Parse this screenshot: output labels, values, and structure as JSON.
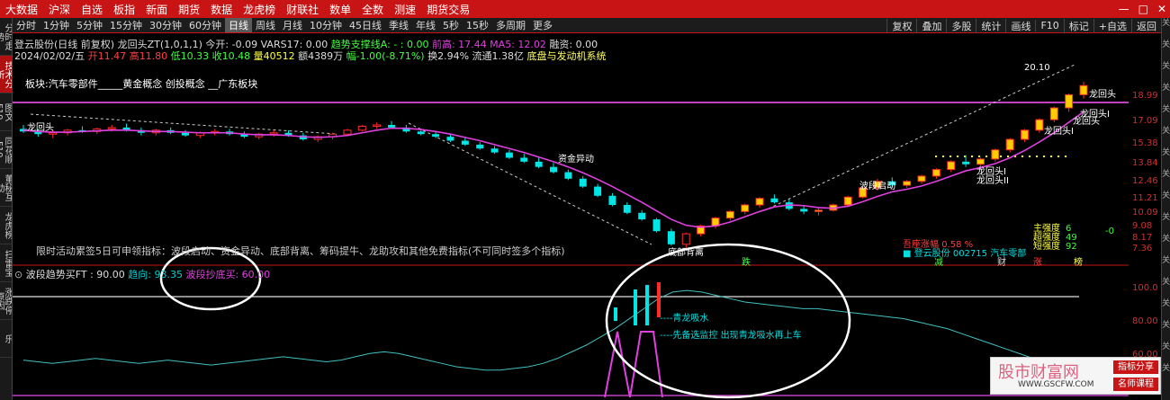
{
  "menu": [
    "大数据",
    "沪深",
    "自选",
    "板指",
    "新面",
    "期货",
    "数据",
    "龙虎榜",
    "财联社",
    "数单",
    "全数",
    "测速",
    "期货交易"
  ],
  "window_controls": [
    "—",
    "□",
    "✕"
  ],
  "left_rail": [
    "分时走势",
    "技术分析",
    "图文F10",
    "同花顺F10",
    "董秘互动",
    "龙虎榜",
    "扫雷宝",
    "涨跌停原因",
    "乐"
  ],
  "right_rail": [
    "关",
    "关",
    "关",
    "关",
    "关",
    "关",
    "关",
    "关",
    "关",
    "关",
    "关",
    "关",
    "关",
    "关",
    "关",
    "关",
    "关"
  ],
  "periods": [
    "分时",
    "1分钟",
    "5分钟",
    "15分钟",
    "30分钟",
    "60分钟",
    "日线",
    "周线",
    "月线",
    "10分钟",
    "45日线",
    "季线",
    "年线",
    "5秒",
    "15秒",
    "多周期",
    "更多"
  ],
  "period_selected": "日线",
  "toolbar_right": [
    "复权",
    "叠加",
    "多股",
    "统计",
    "画线",
    "F10",
    "标记",
    "+自选",
    "返回"
  ],
  "info_line1": {
    "name": "登云股份(日线 前复权)",
    "ind": "龙回头ZT(1,0,1,1)",
    "open": "今开: -0.09",
    "vars": "VARS17: 0.00",
    "support": "趋势支撑线A: - : 0.00",
    "high": "前高: 17.44",
    "ma5": "MA5: 12.02",
    "rz": "融资: 0.00"
  },
  "info_line2": {
    "date": "2024/02/02/五",
    "o": "开11.47",
    "h": "高11.80",
    "l": "低10.33",
    "c": "收10.48",
    "v": "量40512",
    "amt": "额4389万",
    "chg": "幅-1.00(-8.71%)",
    "turn": "换2.94%",
    "flow": "流通1.38亿",
    "concept": "底盘与发动机系统"
  },
  "plate": "板块:汽车零部件_____黄金概念 创投概念 __广东板块",
  "promo": "限时活动累签5日可申领指标：波段启动、资金异动、底部背离、筹码提牛、龙助攻和其他免费指标(不可同时签多个指标)",
  "indicator": {
    "title": "波段趋势买FT : 90.00",
    "trend": "趋向: 93.35",
    "buy": "波段抄底买: 60.00"
  },
  "y_main": [
    "18.99",
    "17.09",
    "15.38",
    "13.84",
    "12.46",
    "11.21",
    "10.09",
    "9.08",
    "8.17",
    "7.36"
  ],
  "y_sub": [
    "100.0",
    "80.00",
    "60.00"
  ],
  "annotations": {
    "peak": "20.10",
    "long1": "龙回头",
    "long2": "龙回头I",
    "long3": "龙回头",
    "long4": "龙回头I",
    "long5": "龙回头II",
    "long_left": "龙回头",
    "fund": "资金异动",
    "bottom": "底部背离",
    "start": "波段启动",
    "qinglong": "----青龙吸水",
    "follow": "----先备选监控  出现青龙吸水再上车",
    "die": "跌",
    "zhang": "涨",
    "jian": "减",
    "cai": "财",
    "bang": "榜"
  },
  "strength": [
    {
      "label": "主强度",
      "value": "6"
    },
    {
      "label": "超强度",
      "value": "49"
    },
    {
      "label": "短强度",
      "value": "92"
    }
  ],
  "strength_extra": "-0",
  "right_info": {
    "up": "吾座涨幅",
    "up_val": "0.58 %",
    "stock": "登云股份",
    "code": "002715",
    "sector": "汽车零部"
  },
  "watermark": {
    "title": "股市财富网",
    "url": "WWW.GSCFW.COM",
    "btn1": "指标分享",
    "btn2": "名师课程"
  },
  "colors": {
    "menu": "#c81414",
    "up": "#ff2a2a",
    "down": "#00e5e5",
    "ma": "#e040e0",
    "yellow": "#ffff00"
  },
  "chart_data": {
    "type": "candlestick",
    "title": "登云股份",
    "period": "日线",
    "y_range": [
      7.0,
      20.5
    ],
    "ylim_sub": [
      40,
      105
    ],
    "candles": [
      [
        16.5,
        16.8,
        16.2,
        16.3
      ],
      [
        16.3,
        16.5,
        15.9,
        16.1
      ],
      [
        16.1,
        16.4,
        15.8,
        16.2
      ],
      [
        16.2,
        16.5,
        16.0,
        16.4
      ],
      [
        16.4,
        16.7,
        16.2,
        16.3
      ],
      [
        16.3,
        16.6,
        16.1,
        16.5
      ],
      [
        16.5,
        16.8,
        16.3,
        16.6
      ],
      [
        16.6,
        16.9,
        16.3,
        16.4
      ],
      [
        16.4,
        16.6,
        16.0,
        16.2
      ],
      [
        16.2,
        16.5,
        16.0,
        16.4
      ],
      [
        16.4,
        16.6,
        16.1,
        16.2
      ],
      [
        16.2,
        16.4,
        15.9,
        16.0
      ],
      [
        16.0,
        16.3,
        15.8,
        16.2
      ],
      [
        16.2,
        16.5,
        16.0,
        16.3
      ],
      [
        16.3,
        16.5,
        16.0,
        16.1
      ],
      [
        16.1,
        16.3,
        15.8,
        15.9
      ],
      [
        15.9,
        16.2,
        15.7,
        16.1
      ],
      [
        16.1,
        16.4,
        15.9,
        16.2
      ],
      [
        16.2,
        16.4,
        15.9,
        16.0
      ],
      [
        16.0,
        16.2,
        15.6,
        15.7
      ],
      [
        15.7,
        16.0,
        15.5,
        15.9
      ],
      [
        15.9,
        16.2,
        15.7,
        16.1
      ],
      [
        16.1,
        16.5,
        16.0,
        16.4
      ],
      [
        16.4,
        16.8,
        16.3,
        16.7
      ],
      [
        16.7,
        17.0,
        16.5,
        16.8
      ],
      [
        16.8,
        17.1,
        16.5,
        16.6
      ],
      [
        16.6,
        16.8,
        16.2,
        16.3
      ],
      [
        16.3,
        16.5,
        16.0,
        16.1
      ],
      [
        16.1,
        16.3,
        15.8,
        15.9
      ],
      [
        15.9,
        16.1,
        15.5,
        15.6
      ],
      [
        15.6,
        15.8,
        15.2,
        15.3
      ],
      [
        15.3,
        15.5,
        14.9,
        15.0
      ],
      [
        15.0,
        15.2,
        14.6,
        14.7
      ],
      [
        14.7,
        14.9,
        14.2,
        14.3
      ],
      [
        14.3,
        14.6,
        13.9,
        14.0
      ],
      [
        14.0,
        14.3,
        13.5,
        13.6
      ],
      [
        13.6,
        13.9,
        13.1,
        13.2
      ],
      [
        13.2,
        13.4,
        12.6,
        12.7
      ],
      [
        12.7,
        12.9,
        12.0,
        12.1
      ],
      [
        12.1,
        12.3,
        11.3,
        11.4
      ],
      [
        11.4,
        11.6,
        10.6,
        10.7
      ],
      [
        10.7,
        10.9,
        10.0,
        10.1
      ],
      [
        10.1,
        10.3,
        9.5,
        9.6
      ],
      [
        9.6,
        9.7,
        8.6,
        8.7
      ],
      [
        8.7,
        8.9,
        7.6,
        7.7
      ],
      [
        7.7,
        8.6,
        7.4,
        8.5
      ],
      [
        8.5,
        9.2,
        8.3,
        9.1
      ],
      [
        9.1,
        9.8,
        8.9,
        9.7
      ],
      [
        9.7,
        10.3,
        9.5,
        10.2
      ],
      [
        10.2,
        10.8,
        10.0,
        10.7
      ],
      [
        10.7,
        11.3,
        10.5,
        11.2
      ],
      [
        11.2,
        11.5,
        10.8,
        10.9
      ],
      [
        10.9,
        11.1,
        10.3,
        10.4
      ],
      [
        10.4,
        10.6,
        10.0,
        10.2
      ],
      [
        10.2,
        10.5,
        9.9,
        10.3
      ],
      [
        10.3,
        10.8,
        10.2,
        10.7
      ],
      [
        10.7,
        11.4,
        10.6,
        11.3
      ],
      [
        11.3,
        12.1,
        11.2,
        12.0
      ],
      [
        12.0,
        12.7,
        11.8,
        12.5
      ],
      [
        12.5,
        12.8,
        12.0,
        12.2
      ],
      [
        12.2,
        12.6,
        12.0,
        12.5
      ],
      [
        12.5,
        13.0,
        12.3,
        12.9
      ],
      [
        12.9,
        13.5,
        12.7,
        13.4
      ],
      [
        13.4,
        14.1,
        13.2,
        14.0
      ],
      [
        14.0,
        14.5,
        13.6,
        13.8
      ],
      [
        13.8,
        14.3,
        13.5,
        14.2
      ],
      [
        14.2,
        15.0,
        14.0,
        14.9
      ],
      [
        14.9,
        15.8,
        14.7,
        15.7
      ],
      [
        15.7,
        16.5,
        15.5,
        16.4
      ],
      [
        16.4,
        17.3,
        16.2,
        17.2
      ],
      [
        17.2,
        18.2,
        17.0,
        18.1
      ],
      [
        18.1,
        19.2,
        17.8,
        19.1
      ],
      [
        19.1,
        20.1,
        18.8,
        19.8
      ]
    ],
    "ma": [
      16.4,
      16.3,
      16.25,
      16.25,
      16.3,
      16.35,
      16.4,
      16.4,
      16.35,
      16.3,
      16.3,
      16.25,
      16.2,
      16.2,
      16.2,
      16.1,
      16.05,
      16.05,
      16.0,
      15.9,
      15.85,
      15.9,
      16.0,
      16.2,
      16.4,
      16.55,
      16.55,
      16.45,
      16.3,
      16.1,
      15.85,
      15.6,
      15.3,
      15.0,
      14.7,
      14.35,
      14.0,
      13.6,
      13.15,
      12.65,
      12.1,
      11.5,
      10.9,
      10.25,
      9.6,
      9.15,
      9.0,
      9.1,
      9.4,
      9.8,
      10.2,
      10.55,
      10.7,
      10.65,
      10.5,
      10.45,
      10.6,
      10.95,
      11.35,
      11.7,
      11.9,
      12.15,
      12.5,
      12.9,
      13.3,
      13.55,
      13.85,
      14.3,
      14.85,
      15.5,
      16.2,
      17.0,
      17.8
    ],
    "sub_line": [
      57,
      56,
      55,
      56,
      57,
      58,
      57,
      56,
      55,
      56,
      57,
      56,
      55,
      54,
      55,
      56,
      57,
      58,
      59,
      58,
      57,
      56,
      57,
      59,
      61,
      62,
      61,
      59,
      57,
      55,
      53,
      52,
      51,
      51,
      52,
      53,
      55,
      58,
      62,
      66,
      71,
      76,
      82,
      88,
      94,
      98,
      99,
      98,
      96,
      94,
      92,
      91,
      90,
      89,
      88,
      88,
      87,
      86,
      85,
      84,
      83,
      82,
      80,
      78,
      76,
      73,
      70,
      67,
      64,
      61,
      58,
      55,
      52
    ]
  }
}
